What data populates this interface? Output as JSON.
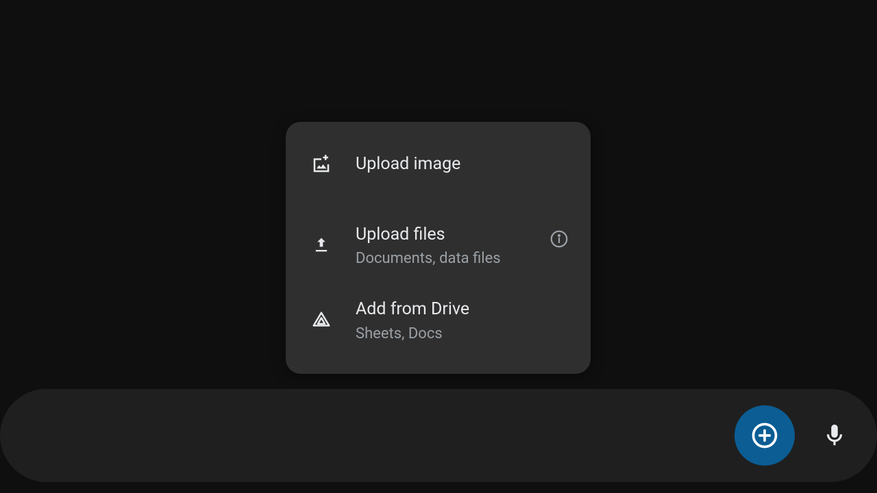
{
  "menu": {
    "items": [
      {
        "title": "Upload image",
        "subtitle": null
      },
      {
        "title": "Upload files",
        "subtitle": "Documents, data files"
      },
      {
        "title": "Add from Drive",
        "subtitle": "Sheets, Docs"
      }
    ]
  },
  "colors": {
    "background": "#0f0f0f",
    "menu_bg": "#2f2f2f",
    "input_bar_bg": "#1f1f1f",
    "add_button_bg": "#0b5d94",
    "text_primary": "#e8eaed",
    "text_secondary": "#9aa0a6"
  }
}
